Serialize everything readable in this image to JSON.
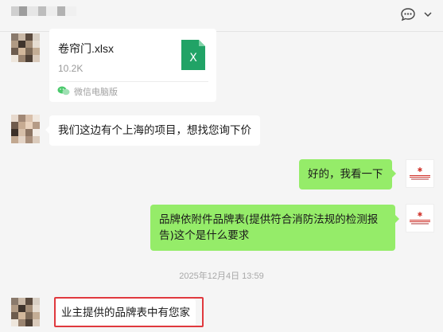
{
  "header": {
    "chat_icon": "chat-bubble-icon",
    "chevron_icon": "chevron-down-icon"
  },
  "messages": {
    "file": {
      "name": "卷帘门.xlsx",
      "size": "10.2K",
      "source": "微信电脑版",
      "icon": "excel-file-icon",
      "icon_letter": "X"
    },
    "m1": "我们这边有个上海的项目，想找您询下价",
    "m2": "好的，我看一下",
    "m3": "品牌依附件品牌表(提供符合消防法规的检测报告)这个是什么要求",
    "timestamp": "2025年12月4日 13:59",
    "m4": "业主提供的品牌表中有您家"
  },
  "colors": {
    "self_bubble": "#95ec69",
    "other_bubble": "#ffffff",
    "excel_green": "#21a366",
    "highlight_border": "#e0393e"
  }
}
